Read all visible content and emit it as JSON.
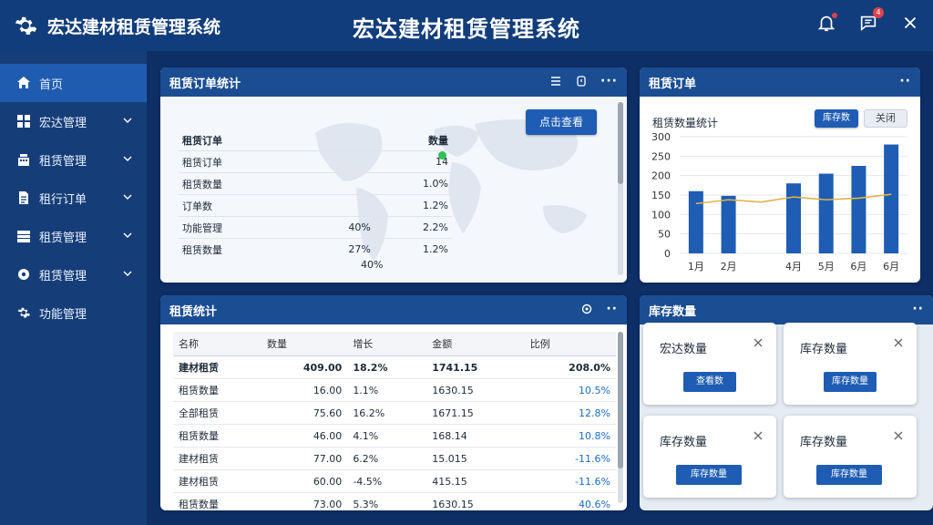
{
  "app": {
    "brand": "宏达建材租赁管理系统",
    "title": "宏达建材租赁管理系统",
    "notification_count": "4"
  },
  "sidebar": {
    "items": [
      {
        "label": "首页"
      },
      {
        "label": "宏达管理"
      },
      {
        "label": "租赁管理"
      },
      {
        "label": "租行订单"
      },
      {
        "label": "租赁管理"
      },
      {
        "label": "租赁管理"
      },
      {
        "label": "功能管理"
      }
    ]
  },
  "order_stats": {
    "title": "租赁订单统计",
    "button": "点击查看",
    "headers": [
      "租赁订单",
      "数量"
    ],
    "rows": [
      [
        "租赁订单",
        "",
        "14"
      ],
      [
        "租赁数量",
        "",
        "1.0%"
      ],
      [
        "订单数",
        "",
        "1.2%"
      ],
      [
        "功能管理",
        "40%",
        "2.2%"
      ],
      [
        "租赁数量",
        "27%",
        "1.2%"
      ]
    ],
    "footer_value": "40%"
  },
  "rental_stats": {
    "title": "租赁统计",
    "headers": [
      "名称",
      "数量",
      "增长",
      "金额",
      "比例"
    ],
    "rows": [
      {
        "name": "建材租赁",
        "qty": "409.00",
        "growth": "18.2%",
        "amount": "1741.15",
        "ratio": "208.0%",
        "bold": true
      },
      {
        "name": "租赁数量",
        "qty": "16.00",
        "growth": "1.1%",
        "amount": "1630.15",
        "ratio": "10.5%"
      },
      {
        "name": "全部租赁",
        "qty": "75.60",
        "growth": "16.2%",
        "amount": "1671.15",
        "ratio": "12.8%"
      },
      {
        "name": "租赁数量",
        "qty": "46.00",
        "growth": "4.1%",
        "amount": "168.14",
        "ratio": "10.8%"
      },
      {
        "name": "建材租赁",
        "qty": "77.00",
        "growth": "6.2%",
        "amount": "15.015",
        "ratio": "-11.6%"
      },
      {
        "name": "建材租赁",
        "qty": "60.00",
        "growth": "-4.5%",
        "amount": "415.15",
        "ratio": "-11.6%"
      },
      {
        "name": "租赁数量",
        "qty": "73.00",
        "growth": "5.3%",
        "amount": "1630.15",
        "ratio": "40.6%"
      }
    ]
  },
  "rental_orders": {
    "title": "租赁订单",
    "label": "租赁数量统计",
    "btn_primary": "库存数",
    "btn_secondary": "关闭"
  },
  "inventory": {
    "title": "库存数量",
    "cards": [
      {
        "title": "宏达数量",
        "button": "查看数"
      },
      {
        "title": "库存数量",
        "button": "库存数量"
      },
      {
        "title": "库存数量",
        "button": "库存数量"
      },
      {
        "title": "库存数量",
        "button": "库存数量"
      }
    ]
  },
  "chart_data": {
    "type": "bar",
    "categories": [
      "1月",
      "2月",
      "",
      "4月",
      "5月",
      "6月",
      "6月"
    ],
    "values": [
      160,
      148,
      null,
      180,
      205,
      225,
      280
    ],
    "line": [
      128,
      138,
      132,
      145,
      138,
      142,
      152
    ],
    "ylim": [
      0,
      300
    ],
    "yticks": [
      0,
      50,
      100,
      150,
      200,
      250,
      300
    ],
    "bar_color": "#1e5db3",
    "line_color": "#e0b34a"
  }
}
